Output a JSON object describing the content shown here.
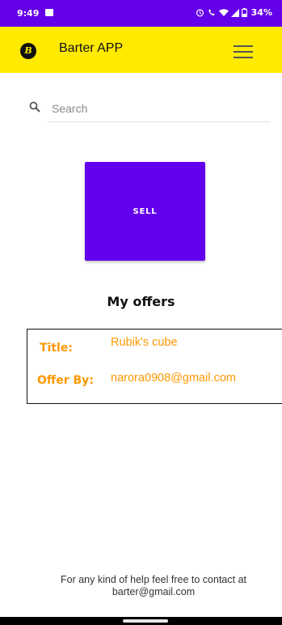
{
  "status_bar": {
    "time": "9:49",
    "battery": "34%"
  },
  "app_bar": {
    "logo_letter": "B",
    "title": "Barter APP"
  },
  "search": {
    "placeholder": "Search",
    "value": ""
  },
  "sell_button": {
    "label": "SELL"
  },
  "offers": {
    "heading": "My offers",
    "items": [
      {
        "title_label": "Title:",
        "title_value": "Rubik's cube",
        "by_label": "Offer By:",
        "by_value": "narora0908@gmail.com"
      }
    ]
  },
  "footer": {
    "line1": "For any kind of help feel free to contact at",
    "line2": "barter@gmail.com"
  },
  "colors": {
    "status_bar": "#6400ea",
    "app_bar": "#ffea00",
    "primary": "#6200ee",
    "offer_text": "#ff9800"
  }
}
